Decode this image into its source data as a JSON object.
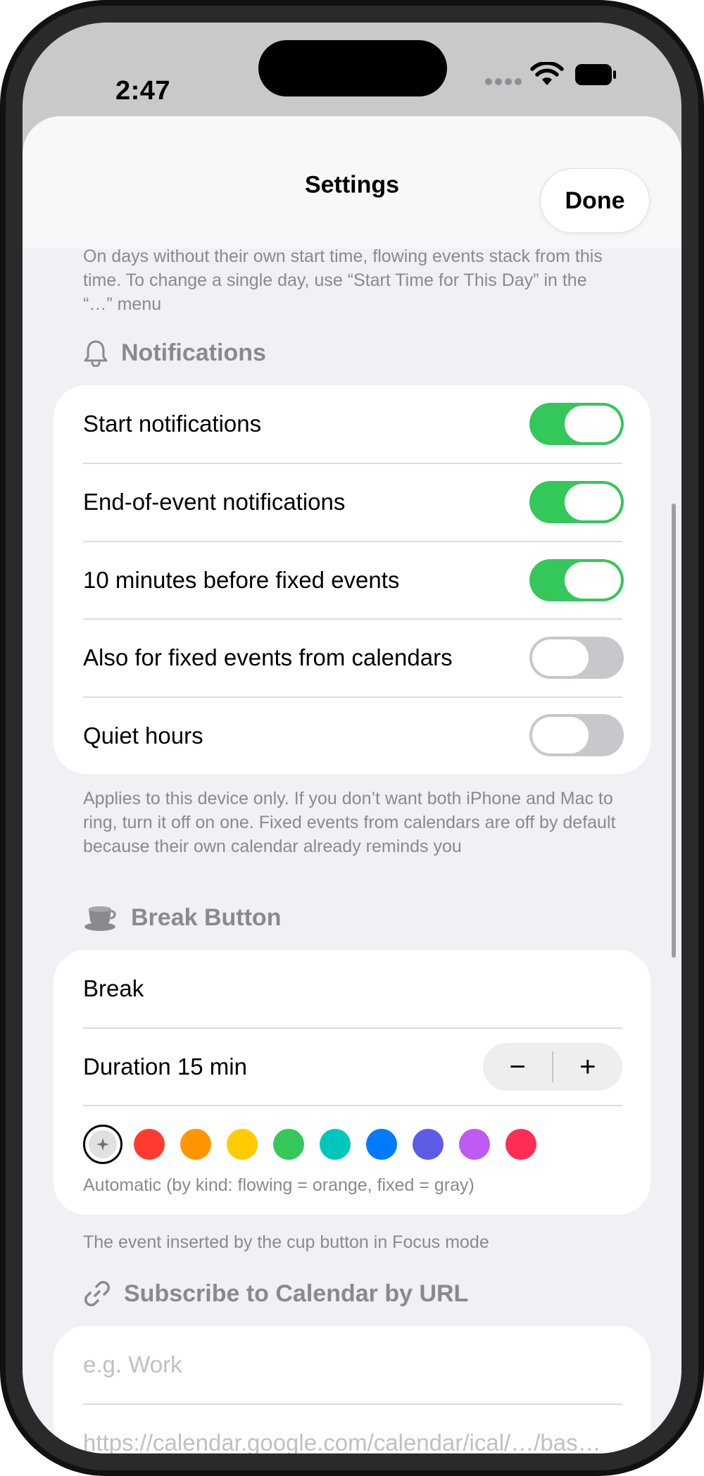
{
  "status_bar": {
    "time": "2:47"
  },
  "sheet": {
    "title": "Settings",
    "done_label": "Done"
  },
  "start_time_footer": "On days without their own start time, flowing events stack from this time. To change a single day, use “Start Time for This Day” in the “…” menu",
  "notifications": {
    "header": "Notifications",
    "icon": "bell-icon",
    "rows": [
      {
        "label": "Start notifications",
        "enabled": true
      },
      {
        "label": "End-of-event notifications",
        "enabled": true
      },
      {
        "label": "10 minutes before fixed events",
        "enabled": true
      },
      {
        "label": "Also for fixed events from calendars",
        "enabled": false
      },
      {
        "label": "Quiet hours",
        "enabled": false
      }
    ],
    "footer": "Applies to this device only. If you don’t want both iPhone and Mac to ring, turn it off on one. Fixed events from calendars are off by default because their own calendar already reminds you"
  },
  "break_button": {
    "header": "Break Button",
    "icon": "cup-icon",
    "name_value": "Break",
    "duration_label": "Duration 15 min",
    "stepper_minus": "−",
    "stepper_plus": "+",
    "colors": [
      "automatic",
      "#ff3b30",
      "#ff9500",
      "#ffcc00",
      "#34c759",
      "#00c7be",
      "#007aff",
      "#5e5ce6",
      "#bf5af2",
      "#ff2d55"
    ],
    "selected_color": "automatic",
    "color_caption": "Automatic (by kind: flowing = orange, fixed = gray)",
    "footer": "The event inserted by the cup button in Focus mode"
  },
  "subscribe": {
    "header": "Subscribe to Calendar by URL",
    "icon": "link-icon",
    "name_placeholder": "e.g. Work",
    "url_placeholder": "https://calendar.google.com/calendar/ical/…/bas…"
  }
}
